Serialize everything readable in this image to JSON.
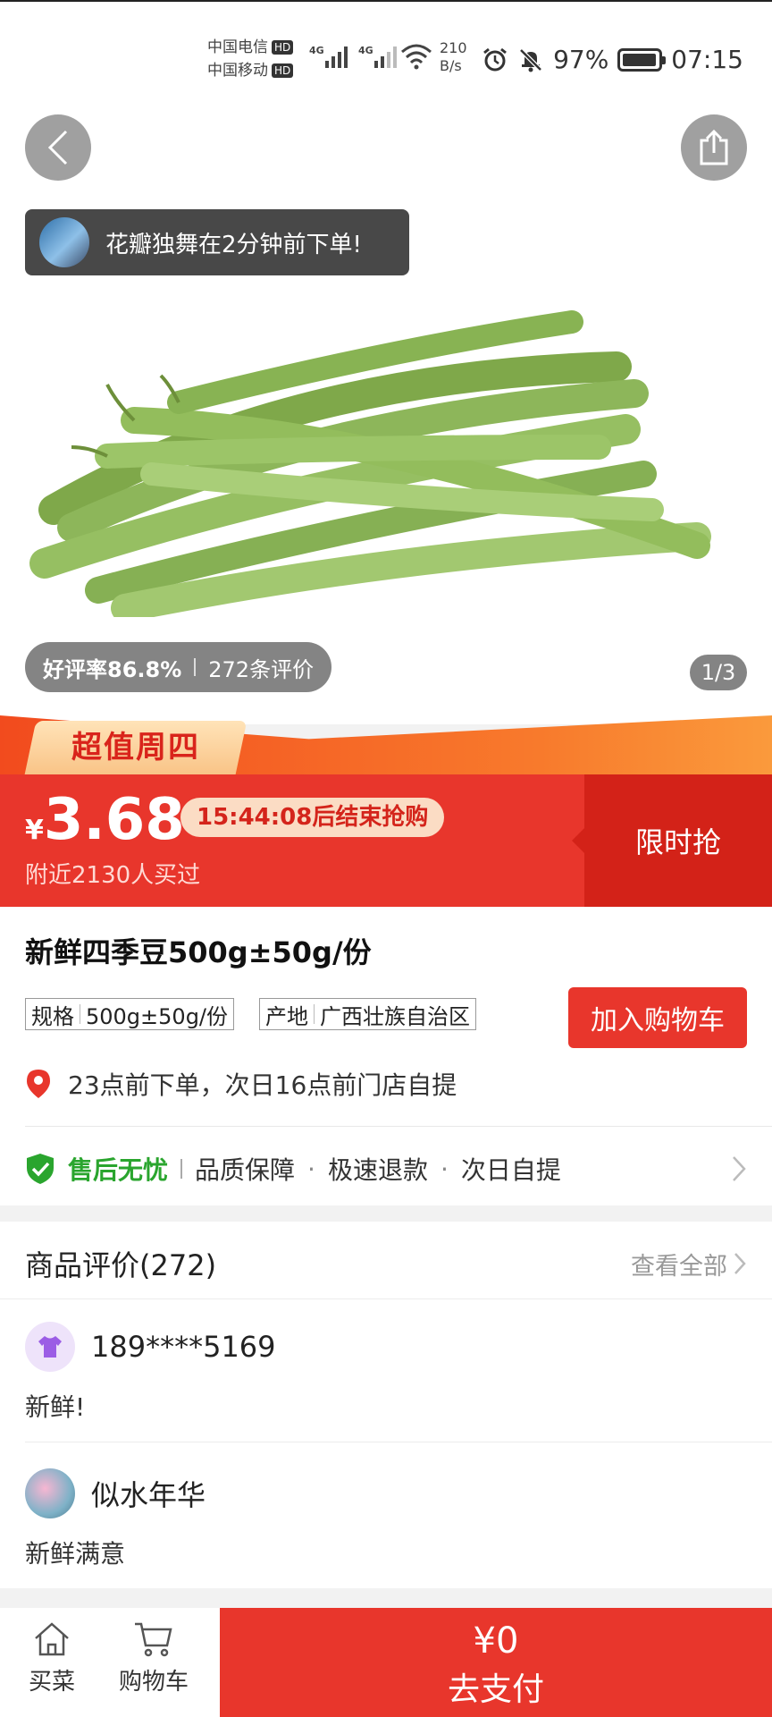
{
  "status_bar": {
    "carrier1": "中国电信",
    "carrier2": "中国移动",
    "hd": "HD",
    "net1": "4G",
    "net2": "4G",
    "speed_value": "210",
    "speed_unit": "B/s",
    "battery": "97%",
    "time": "07:15"
  },
  "hero": {
    "order_toast": "花瓣独舞在2分钟前下单!",
    "rating_label": "好评率86.8%",
    "review_count": "272条评价",
    "pager": "1/3",
    "icons": {
      "back": "chevron-left-icon",
      "share": "share-icon"
    }
  },
  "promo": {
    "tag": "超值周四",
    "currency": "¥",
    "price": "3.68",
    "countdown": "15:44:08后结束抢购",
    "buyers": "附近2130人买过",
    "flash_label": "限时抢"
  },
  "product": {
    "title": "新鲜四季豆500g±50g/份",
    "spec_label": "规格",
    "spec_value": "500g±50g/份",
    "origin_label": "产地",
    "origin_value": "广西壮族自治区",
    "add_cart": "加入购物车",
    "pickup": "23点前下单，次日16点前门店自提"
  },
  "guarantee": {
    "title": "售后无忧",
    "items": [
      "品质保障",
      "极速退款",
      "次日自提"
    ]
  },
  "reviews": {
    "title": "商品评价(272)",
    "view_all": "查看全部",
    "list": [
      {
        "user": "189****5169",
        "text": "新鲜!"
      },
      {
        "user": "似水年华",
        "text": "新鲜满意"
      }
    ]
  },
  "bottom": {
    "tab_home": "买菜",
    "tab_cart": "购物车",
    "pay_amount": "¥0",
    "pay_label": "去支付"
  },
  "colors": {
    "brand_red": "#e8362c",
    "accent_green": "#2aa52e"
  }
}
